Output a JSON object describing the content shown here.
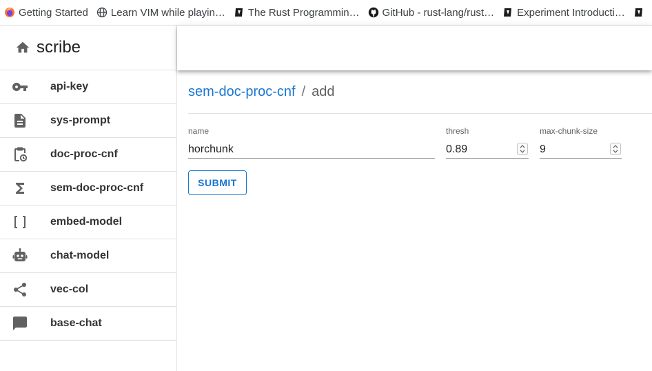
{
  "bookmarks": [
    {
      "label": "Getting Started",
      "icon": "firefox-icon"
    },
    {
      "label": "Learn VIM while playin…",
      "icon": "globe-icon"
    },
    {
      "label": "The Rust Programmin…",
      "icon": "book-icon"
    },
    {
      "label": "GitHub - rust-lang/rust…",
      "icon": "github-icon"
    },
    {
      "label": "Experiment Introducti…",
      "icon": "book-icon"
    }
  ],
  "sidebar": {
    "brand": {
      "title": "scribe",
      "icon": "home-icon"
    },
    "items": [
      {
        "label": "api-key",
        "icon": "key-icon"
      },
      {
        "label": "sys-prompt",
        "icon": "document-icon"
      },
      {
        "label": "doc-proc-cnf",
        "icon": "clipboard-clock-icon"
      },
      {
        "label": "sem-doc-proc-cnf",
        "icon": "sigma-icon"
      },
      {
        "label": "embed-model",
        "icon": "brackets-icon"
      },
      {
        "label": "chat-model",
        "icon": "robot-icon"
      },
      {
        "label": "vec-col",
        "icon": "share-icon"
      },
      {
        "label": "base-chat",
        "icon": "chat-bubble-icon"
      }
    ]
  },
  "breadcrumb": {
    "parent": "sem-doc-proc-cnf",
    "separator": "/",
    "current": "add"
  },
  "form": {
    "name": {
      "label": "name",
      "value": "horchunk"
    },
    "thresh": {
      "label": "thresh",
      "value": "0.89"
    },
    "max_chunk_size": {
      "label": "max-chunk-size",
      "value": "9"
    },
    "submit_label": "SUBMIT"
  },
  "colors": {
    "primary": "#1976d2",
    "icon_gray": "#616161"
  }
}
